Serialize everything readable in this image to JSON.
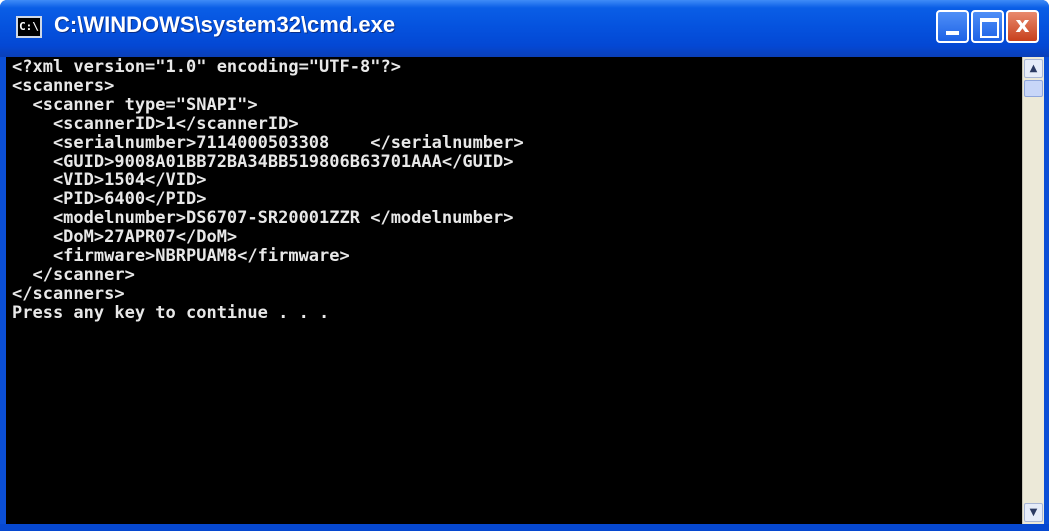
{
  "window": {
    "title": "C:\\WINDOWS\\system32\\cmd.exe",
    "icon_label": "C:\\",
    "icon": "console-icon",
    "controls": {
      "minimize": "minimize-icon",
      "maximize": "maximize-icon",
      "close_label": "x"
    }
  },
  "console": {
    "lines": [
      "<?xml version=\"1.0\" encoding=\"UTF-8\"?>",
      "<scanners>",
      "  <scanner type=\"SNAPI\">",
      "    <scannerID>1</scannerID>",
      "    <serialnumber>7114000503308    </serialnumber>",
      "    <GUID>9008A01BB72BA34BB519806B63701AAA</GUID>",
      "    <VID>1504</VID>",
      "    <PID>6400</PID>",
      "    <modelnumber>DS6707-SR20001ZZR </modelnumber>",
      "    <DoM>27APR07</DoM>",
      "    <firmware>NBRPUAM8</firmware>",
      "  </scanner>",
      "</scanners>",
      "Press any key to continue . . ."
    ]
  },
  "scrollbar": {
    "up": "scroll-up-arrow-icon",
    "down": "scroll-down-arrow-icon",
    "up_glyph": "▲",
    "down_glyph": "▼"
  },
  "colors": {
    "titlebar": "#0553df",
    "console_bg": "#000000",
    "console_text": "#e8e8e8"
  }
}
